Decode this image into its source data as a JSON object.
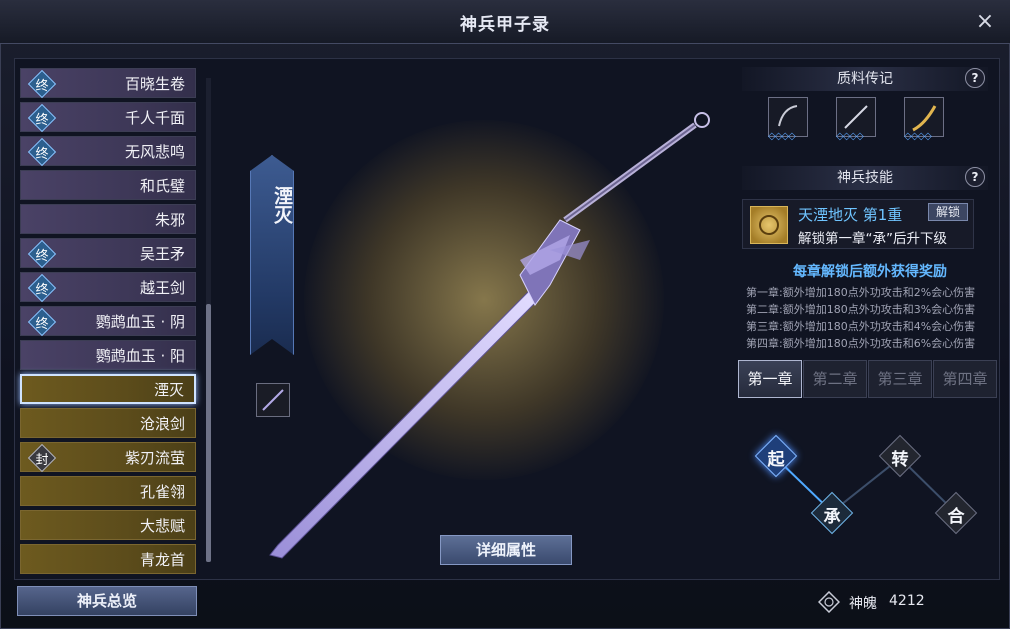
{
  "window": {
    "title": "神兵甲子录",
    "close_icon": "×"
  },
  "list": {
    "items": [
      {
        "label": "百晓生卷",
        "badge": "终",
        "style": "purple"
      },
      {
        "label": "千人千面",
        "badge": "终",
        "style": "purple"
      },
      {
        "label": "无风悲鸣",
        "badge": "终",
        "style": "purple"
      },
      {
        "label": "和氏璧",
        "badge": "",
        "style": "purple"
      },
      {
        "label": "朱邪",
        "badge": "",
        "style": "purple"
      },
      {
        "label": "吴王矛",
        "badge": "终",
        "style": "purple"
      },
      {
        "label": "越王剑",
        "badge": "终",
        "style": "purple"
      },
      {
        "label": "鹦鹉血玉 · 阴",
        "badge": "终",
        "style": "purple"
      },
      {
        "label": "鹦鹉血玉 · 阳",
        "badge": "",
        "style": "purple"
      },
      {
        "label": "湮灭",
        "badge": "",
        "style": "gold",
        "selected": true
      },
      {
        "label": "沧浪剑",
        "badge": "",
        "style": "gold"
      },
      {
        "label": "紫刃流萤",
        "badge": "封",
        "style": "gold"
      },
      {
        "label": "孔雀翎",
        "badge": "",
        "style": "gold"
      },
      {
        "label": "大悲赋",
        "badge": "",
        "style": "gold"
      },
      {
        "label": "青龙首",
        "badge": "",
        "style": "gold"
      }
    ]
  },
  "weapon": {
    "name": "湮灭",
    "detail_button": "详细属性"
  },
  "materials": {
    "header": "质料传记",
    "help": "?"
  },
  "skill": {
    "header": "神兵技能",
    "help": "?",
    "name": "天湮地灭 第1重",
    "unlock_button": "解锁",
    "desc": "解锁第一章“承”后升下级"
  },
  "rewards": {
    "title": "每章解锁后额外获得奖励",
    "lines": [
      "第一章:额外增加180点外功攻击和2%会心伤害",
      "第二章:额外增加180点外功攻击和3%会心伤害",
      "第三章:额外增加180点外功攻击和4%会心伤害",
      "第四章:额外增加180点外功攻击和6%会心伤害"
    ]
  },
  "chapters": [
    "第一章",
    "第二章",
    "第三章",
    "第四章"
  ],
  "nodes": [
    "起",
    "承",
    "转",
    "合"
  ],
  "footer": {
    "overview_button": "神兵总览",
    "soul_label": "神魄",
    "soul_value": "4212"
  },
  "colors": {
    "accent_blue": "#64b8ff",
    "gold_row": "#6d5a1f",
    "purple_row": "#4a4266"
  }
}
